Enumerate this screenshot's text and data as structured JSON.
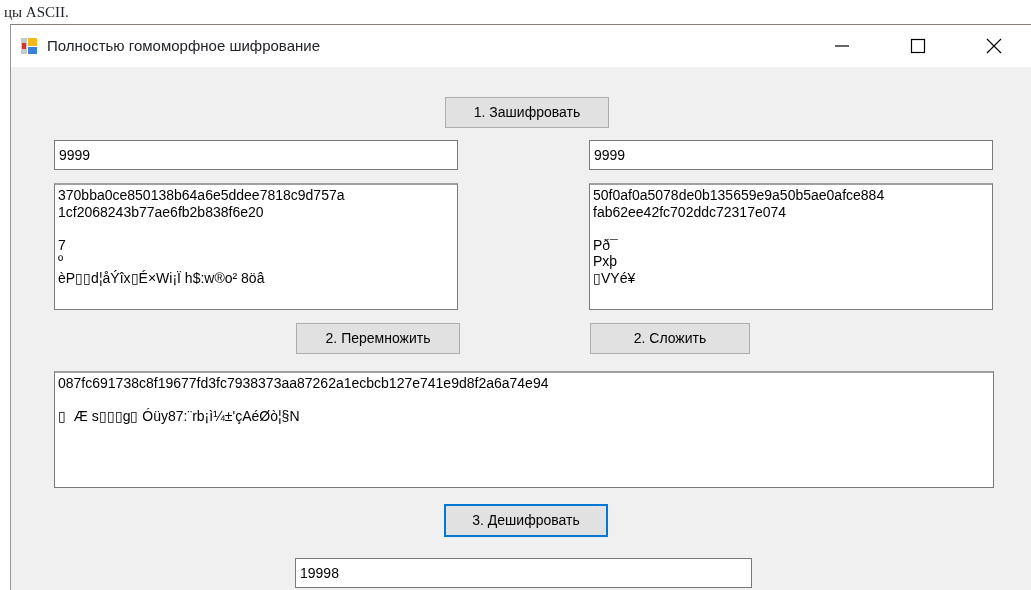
{
  "caption": "цы ASCII.",
  "window": {
    "title": "Полностью гомоморфное шифрование"
  },
  "encrypt_button": {
    "label": "1. Зашифровать",
    "focused": false
  },
  "left": {
    "input": "9999",
    "cipher": "370bba0ce850138b64a6e5ddee7818c9d757a\n1cf2068243b77ae6fb2b838f6e20\n\n7\nº\nèP▯▯d¦åÝîx▯É×Wi¡Ï h$:w®o² 8öâ"
  },
  "right": {
    "input": "9999",
    "cipher": "50f0af0a5078de0b135659e9a50b5ae0afce884\nfab62ee42fc702ddc72317e074\n\nPð¯\nPxþ\n▯VYé¥"
  },
  "multiply_button": {
    "label": "2. Перемножить",
    "focused": false
  },
  "add_button": {
    "label": "2. Сложить",
    "focused": false
  },
  "result_cipher": "087fc691738c8f19677fd3fc7938373aa87262a1ecbcb127e741e9d8f2a6a74e94\n\n▯  Æ s▯▯▯g▯ Óüy87:¨rb¡ì¼±'çAéØò¦§N",
  "decrypt_button": {
    "label": "3. Дешифровать",
    "focused": true
  },
  "output": "19998"
}
